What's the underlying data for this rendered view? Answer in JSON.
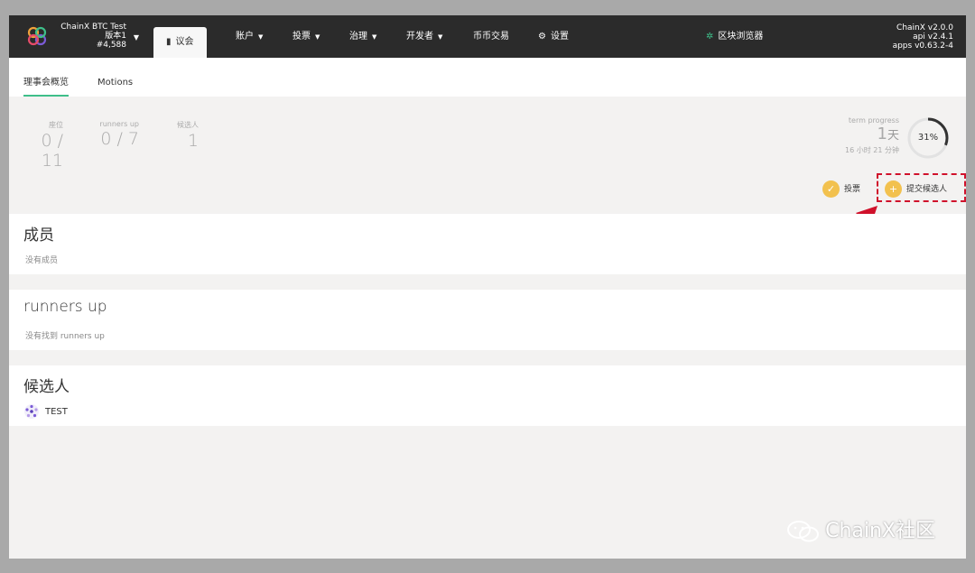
{
  "topbar": {
    "chain_name": "ChainX BTC Test",
    "version": "版本1",
    "block": "#4,588",
    "nav": [
      {
        "label": "议会",
        "active": true
      },
      {
        "label": "账户"
      },
      {
        "label": "投票"
      },
      {
        "label": "治理"
      },
      {
        "label": "开发者"
      },
      {
        "label": "币币交易"
      },
      {
        "label": "设置"
      },
      {
        "label": "区块浏览器"
      }
    ],
    "versions": [
      "ChainX v2.0.0",
      "api v2.4.1",
      "apps v0.63.2-4"
    ]
  },
  "tabs": [
    {
      "label": "理事会概览",
      "active": true
    },
    {
      "label": "Motions"
    }
  ],
  "summary": {
    "seats": {
      "label": "座位",
      "value": "0 / 11"
    },
    "runners": {
      "label": "runners up",
      "value": "0 / 7"
    },
    "candidates": {
      "label": "候选人",
      "value": "1"
    },
    "term": {
      "label": "term progress",
      "days": "1",
      "days_unit": "天",
      "remaining": "16 小时 21 分钟",
      "percent_label": "31%",
      "percent": 0.31
    }
  },
  "actions": {
    "vote": "投票",
    "submit": "提交候选人"
  },
  "members": {
    "title": "成员",
    "empty": "没有成员"
  },
  "runners_up": {
    "title": "runners up",
    "empty": "没有找到 runners up"
  },
  "candidates": {
    "title": "候选人",
    "items": [
      {
        "name": "TEST"
      }
    ]
  },
  "watermark": "ChainX社区",
  "colors": {
    "accent": "#3ebf8a",
    "action": "#f2c14e",
    "highlight": "#d0112b",
    "topbar": "#2b2b2b"
  }
}
